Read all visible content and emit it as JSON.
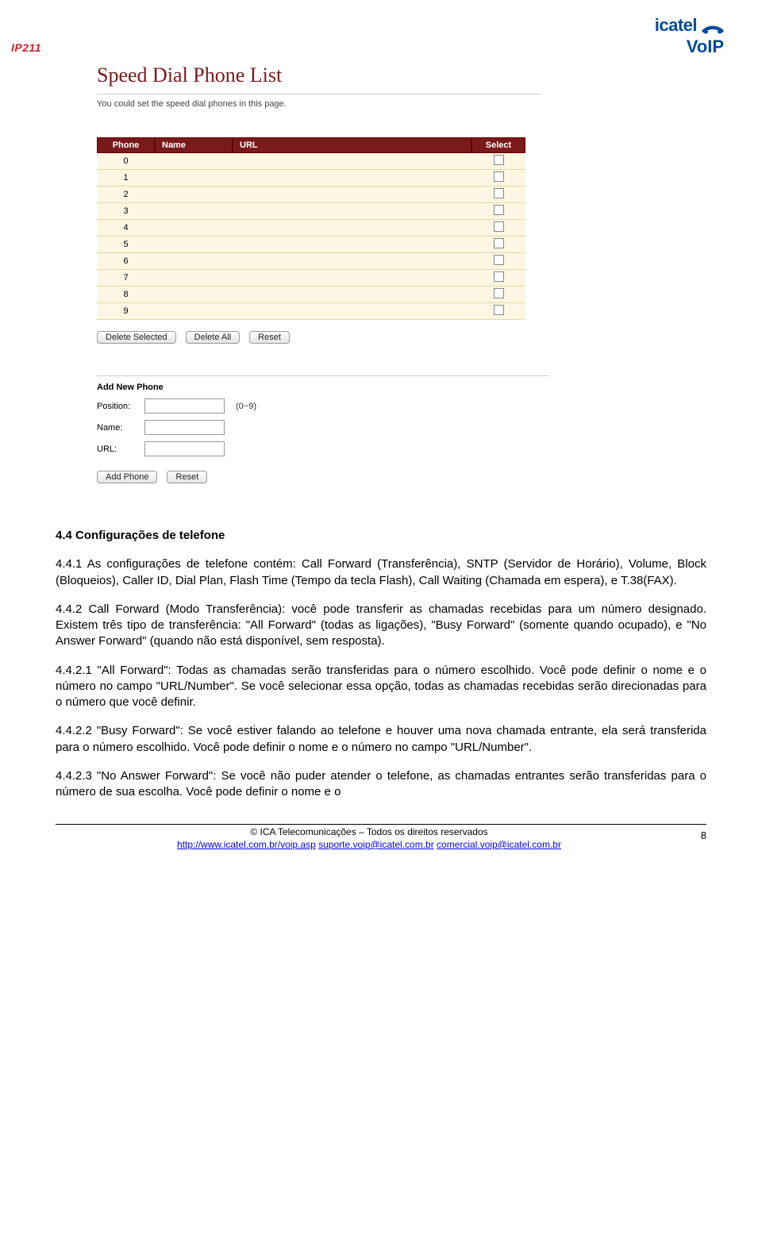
{
  "brand": {
    "left": "IP211",
    "right_top": "icatel",
    "right_bottom": "VoIP"
  },
  "shot": {
    "title": "Speed Dial Phone List",
    "subtitle": "You could set the speed dial phones in this page.",
    "table": {
      "headers": [
        "Phone",
        "Name",
        "URL",
        "Select"
      ],
      "rows": [
        "0",
        "1",
        "2",
        "3",
        "4",
        "5",
        "6",
        "7",
        "8",
        "9"
      ]
    },
    "buttons1": {
      "del_sel": "Delete Selected",
      "del_all": "Delete All",
      "reset1": "Reset"
    },
    "add_section": "Add New Phone",
    "form": {
      "position_label": "Position:",
      "position_hint": "(0~9)",
      "name_label": "Name:",
      "url_label": "URL:"
    },
    "buttons2": {
      "add": "Add Phone",
      "reset2": "Reset"
    }
  },
  "doc": {
    "h1": "4.4 Configurações de telefone",
    "p1": "4.4.1 As configurações de telefone contém: Call Forward (Transferência), SNTP (Servidor de Horário), Volume, Block (Bloqueios), Caller ID, Dial Plan, Flash Time (Tempo da tecla Flash), Call Waiting (Chamada em espera), e T.38(FAX).",
    "p2": "4.4.2 Call Forward (Modo Transferência): você pode transferir as chamadas recebidas para um número designado. Existem três tipo de transferência: \"All Forward\" (todas as ligações), \"Busy Forward\" (somente quando ocupado), e \"No Answer Forward\" (quando não está disponível, sem resposta).",
    "p3": "4.4.2.1 \"All Forward\": Todas as chamadas serão transferidas para o número escolhido. Você pode definir o nome e o número no campo \"URL/Number\". Se você selecionar essa opção, todas as chamadas recebidas serão direcionadas para o número que você definir.",
    "p4": "4.4.2.2 \"Busy Forward\": Se você estiver falando ao telefone e houver uma nova chamada entrante, ela será transferida para o número escolhido. Você pode definir o nome e o número no campo \"URL/Number\".",
    "p5": "4.4.2.3 \"No Answer Forward\": Se você não puder atender o telefone, as chamadas entrantes serão transferidas para o número de sua escolha. Você pode definir o nome e o"
  },
  "footer": {
    "line1": "© ICA Telecomunicações – Todos os direitos reservados",
    "link": "http://www.icatel.com.br/voip.asp",
    "email1": "suporte.voip@icatel.com.br",
    "email2": "comercial.voip@icatel.com.br",
    "page": "8"
  }
}
